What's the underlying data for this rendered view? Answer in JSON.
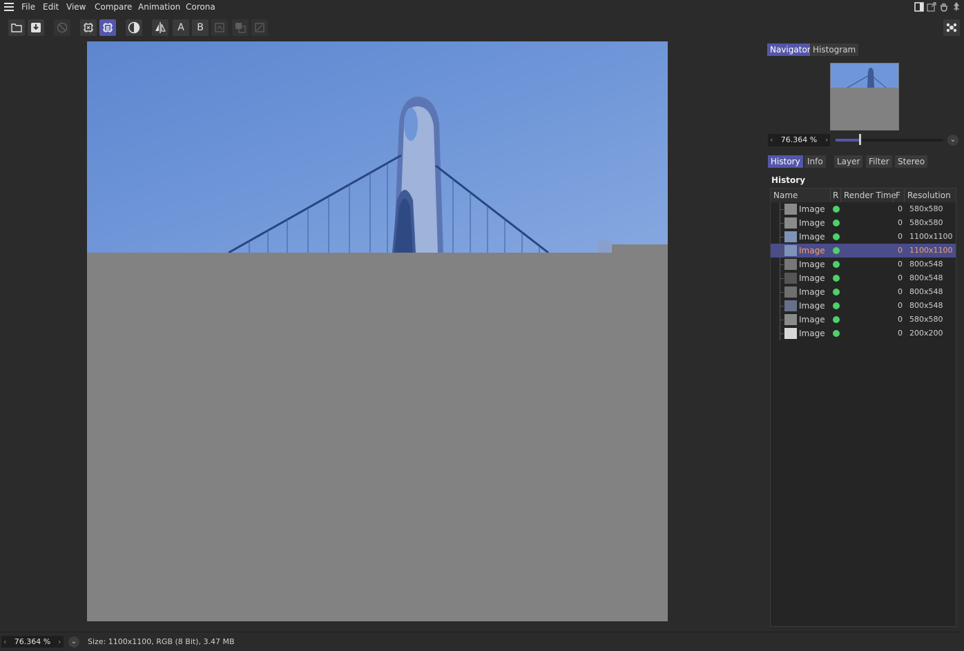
{
  "menu": {
    "items": [
      "File",
      "Edit",
      "View",
      "Compare",
      "Animation",
      "Corona"
    ]
  },
  "window_icons": [
    "panel-layout-icon",
    "popout-icon",
    "hand-icon",
    "pin-icon"
  ],
  "toolbar": {
    "ab_a": "A",
    "ab_b": "B"
  },
  "navigator": {
    "tabs": [
      "Navigator",
      "Histogram"
    ],
    "active_tab": "Navigator",
    "zoom": "76.364 %",
    "zoom_fraction": 0.22
  },
  "panel_tabs": {
    "items": [
      "History",
      "Info",
      "Layer",
      "Filter",
      "Stereo"
    ],
    "active": "History"
  },
  "history": {
    "title": "History",
    "columns": [
      "Name",
      "R",
      "Render Time",
      "F",
      "Resolution"
    ],
    "rows": [
      {
        "name": "Image",
        "status": "green",
        "render_time": "",
        "frame": "0",
        "resolution": "580x580",
        "selected": false
      },
      {
        "name": "Image",
        "status": "green",
        "render_time": "",
        "frame": "0",
        "resolution": "580x580",
        "selected": false
      },
      {
        "name": "Image",
        "status": "green",
        "render_time": "",
        "frame": "0",
        "resolution": "1100x1100",
        "selected": false
      },
      {
        "name": "Image",
        "status": "green",
        "render_time": "",
        "frame": "0",
        "resolution": "1100x1100",
        "selected": true
      },
      {
        "name": "Image",
        "status": "green",
        "render_time": "",
        "frame": "0",
        "resolution": "800x548",
        "selected": false
      },
      {
        "name": "Image",
        "status": "green",
        "render_time": "",
        "frame": "0",
        "resolution": "800x548",
        "selected": false
      },
      {
        "name": "Image",
        "status": "green",
        "render_time": "",
        "frame": "0",
        "resolution": "800x548",
        "selected": false
      },
      {
        "name": "Image",
        "status": "green",
        "render_time": "",
        "frame": "0",
        "resolution": "800x548",
        "selected": false
      },
      {
        "name": "Image",
        "status": "green",
        "render_time": "",
        "frame": "0",
        "resolution": "580x580",
        "selected": false
      },
      {
        "name": "Image",
        "status": "green",
        "render_time": "",
        "frame": "0",
        "resolution": "200x200",
        "selected": false
      }
    ]
  },
  "status": {
    "zoom": "76.364 %",
    "text": "Size: 1100x1100, RGB (8 Bit), 3.47 MB"
  },
  "colors": {
    "accent": "#5457a8",
    "status_green": "#4fd06a",
    "selected_text": "#f0a070",
    "sky": "#6f96d8",
    "gray_fill": "#828282"
  }
}
